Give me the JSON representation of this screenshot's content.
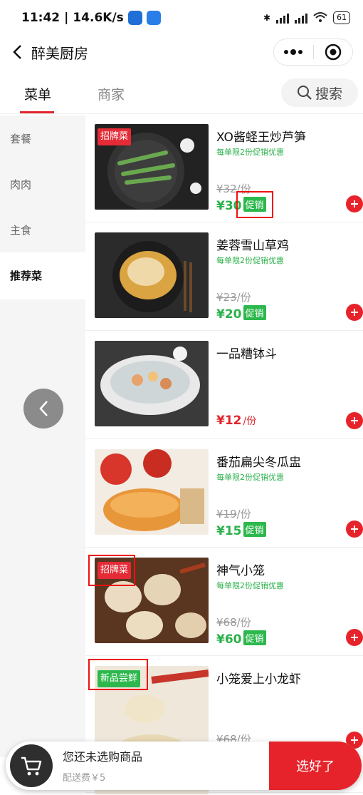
{
  "status_bar": {
    "time": "11:42",
    "speed": "14.6K/s",
    "battery": "61"
  },
  "nav": {
    "title": "醉美厨房"
  },
  "tabs": [
    {
      "label": "菜单"
    },
    {
      "label": "商家"
    }
  ],
  "search": {
    "label": "搜索"
  },
  "categories": [
    {
      "label": "套餐"
    },
    {
      "label": "肉肉"
    },
    {
      "label": "主食"
    },
    {
      "label": "推荐菜"
    }
  ],
  "items": [
    {
      "name": "XO酱蛏王炒芦笋",
      "promo": "每单限2份促销优惠",
      "orig_price": "¥32",
      "orig_unit": "/份",
      "price": "¥30",
      "unit": "",
      "badge": "促销",
      "tag": "招牌菜"
    },
    {
      "name": "姜蓉雪山草鸡",
      "promo": "每单限2份促销优惠",
      "orig_price": "¥23",
      "orig_unit": "/份",
      "price": "¥20",
      "unit": "",
      "badge": "促销",
      "tag": ""
    },
    {
      "name": "一品糟钵斗",
      "promo": "",
      "orig_price": "",
      "orig_unit": "",
      "price": "¥12",
      "unit": "/份",
      "badge": "",
      "tag": ""
    },
    {
      "name": "番茄扁尖冬瓜盅",
      "promo": "每单限2份促销优惠",
      "orig_price": "¥19",
      "orig_unit": "/份",
      "price": "¥15",
      "unit": "",
      "badge": "促销",
      "tag": ""
    },
    {
      "name": "神气小笼",
      "promo": "每单限2份促销优惠",
      "orig_price": "¥68",
      "orig_unit": "/份",
      "price": "¥60",
      "unit": "",
      "badge": "促销",
      "tag": "招牌菜"
    },
    {
      "name": "小笼爱上小龙虾",
      "promo": "",
      "orig_price": "¥68",
      "orig_unit": "/份",
      "price": "",
      "unit": "",
      "badge": "",
      "tag": "新品尝鲜"
    }
  ],
  "cart": {
    "status": "您还未选购商品",
    "fee": "配送费￥5",
    "checkout": "选好了"
  },
  "colors": {
    "accent": "#e6232b",
    "promo_green": "#2db84d"
  }
}
